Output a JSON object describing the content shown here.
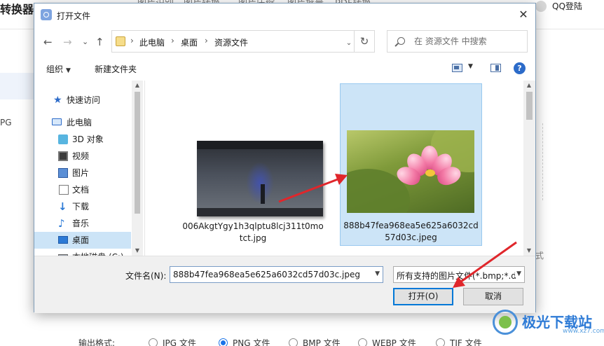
{
  "background": {
    "brand": "转换器",
    "top_tabs": [
      "图片识别",
      "图片转换",
      "图片压缩",
      "图片批量",
      "PDF转换"
    ],
    "login": "QQ登陆",
    "sidebar_partial": "PG",
    "partial_right_label": "式",
    "output_format_label": "输出格式:",
    "formats": [
      {
        "label": "JPG 文件",
        "selected": false
      },
      {
        "label": "PNG 文件",
        "selected": true
      },
      {
        "label": "BMP 文件",
        "selected": false
      },
      {
        "label": "WEBP 文件",
        "selected": false
      },
      {
        "label": "TIF 文件",
        "selected": false
      }
    ]
  },
  "dialog": {
    "title": "打开文件",
    "close_glyph": "✕",
    "nav": {
      "back": "←",
      "forward": "→",
      "recent": "⌄",
      "up": "↑",
      "refresh": "↻"
    },
    "address": {
      "segments": [
        "此电脑",
        "桌面",
        "资源文件"
      ],
      "sep": "›",
      "dropdown": "⌄"
    },
    "search": {
      "placeholder": "在 资源文件 中搜索"
    },
    "toolbar": {
      "organize": "组织",
      "new_folder": "新建文件夹",
      "caret": "▼",
      "help": "?"
    },
    "tree": [
      {
        "label": "快速访问",
        "icon": "star-icon",
        "indent": 0,
        "selected": false
      },
      {
        "label": "此电脑",
        "icon": "computer-icon",
        "indent": 0,
        "selected": false
      },
      {
        "label": "3D 对象",
        "icon": "3d-objects-icon",
        "indent": 1,
        "selected": false
      },
      {
        "label": "视频",
        "icon": "video-icon",
        "indent": 1,
        "selected": false
      },
      {
        "label": "图片",
        "icon": "pictures-icon",
        "indent": 1,
        "selected": false
      },
      {
        "label": "文档",
        "icon": "documents-icon",
        "indent": 1,
        "selected": false
      },
      {
        "label": "下载",
        "icon": "download-icon",
        "indent": 1,
        "selected": false
      },
      {
        "label": "音乐",
        "icon": "music-icon",
        "indent": 1,
        "selected": false
      },
      {
        "label": "桌面",
        "icon": "desktop-icon",
        "indent": 1,
        "selected": true
      },
      {
        "label": "本地磁盘 (C:)",
        "icon": "disk-icon",
        "indent": 1,
        "selected": false
      }
    ],
    "files": [
      {
        "name": "006AkgtYgy1h3qlptu8lcj311t0motct.jpg",
        "selected": false,
        "thumb": "dark-scene"
      },
      {
        "name": "888b47fea968ea5e625a6032cd57d03c.jpeg",
        "selected": true,
        "thumb": "lotus"
      }
    ],
    "bottom": {
      "filename_label": "文件名(N):",
      "filename_value": "888b47fea968ea5e625a6032cd57d03c.jpeg",
      "filter_value": "所有支持的图片文件(*.bmp;*.d",
      "open_label": "打开(O)",
      "cancel_label": "取消"
    }
  },
  "watermark": {
    "text": "极光下载站",
    "sub": "www.xz7.com"
  },
  "colors": {
    "selection": "#cce4f7",
    "accent": "#0078d7",
    "arrow": "#e0262b"
  }
}
